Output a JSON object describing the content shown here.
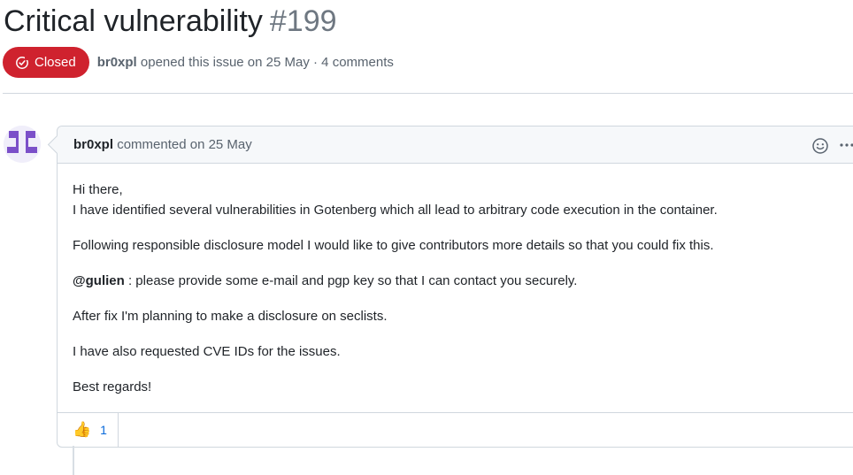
{
  "issue": {
    "title": "Critical vulnerability",
    "number": "#199",
    "state": "Closed",
    "state_color": "#cf222e",
    "author": "br0xpl",
    "opened_text": "opened this issue on 25 May · 4 comments"
  },
  "comment": {
    "author": "br0xpl",
    "action_text": "commented on 25 May",
    "icons": {
      "emoji": "smiley-icon",
      "more": "kebab-horizontal-icon"
    },
    "body": {
      "line1": "Hi there,",
      "line2": "I have identified several vulnerabilities in Gotenberg which all lead to arbitrary code execution in the container.",
      "para2": "Following responsible disclosure model I would like to give contributors more details so that you could fix this.",
      "mention": "@gulien",
      "para3_rest": " : please provide some e-mail and pgp key so that I can contact you securely.",
      "para4": "After fix I'm planning to make a disclosure on seclists.",
      "para5": "I have also requested CVE IDs for the issues.",
      "para6": "Best regards!"
    },
    "reaction": {
      "icon": "thumbs-up-icon",
      "count": "1"
    }
  }
}
